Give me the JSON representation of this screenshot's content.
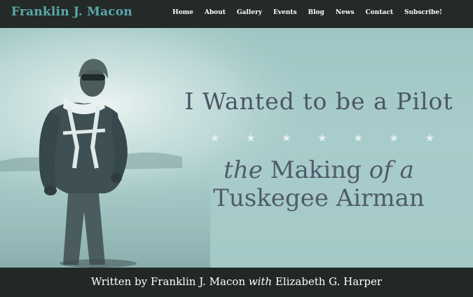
{
  "header": {
    "brand": "Franklin J. Macon",
    "nav": [
      "Home",
      "About",
      "Gallery",
      "Events",
      "Blog",
      "News",
      "Contact",
      "Subscribe!"
    ]
  },
  "hero": {
    "headline": "I Wanted to be a Pilot",
    "stars": [
      "★",
      "★",
      "★",
      "★",
      "★",
      "★",
      "★"
    ],
    "subtitle_line1_italic": "the",
    "subtitle_line1_rest": " Making ",
    "subtitle_line1_italic2": "of a",
    "subtitle_line2": "Tuskegee Airman",
    "image_icon": "vintage-aviator-photo"
  },
  "footer": {
    "by_prefix": "Written by Franklin J. Macon ",
    "with": "with",
    "coauthor": " Elizabeth G. Harper"
  },
  "colors": {
    "brand": "#5aa9ae",
    "nav_bg": "#242a27",
    "hero_bg": "#a4c9c7",
    "headline": "#4d5566",
    "stars": "#e7f1f1"
  }
}
